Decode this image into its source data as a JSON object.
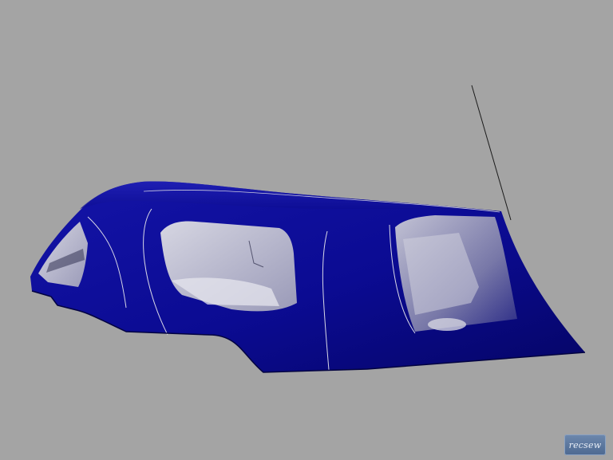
{
  "scene": {
    "subject": "boat-canopy-render",
    "colors": {
      "background": "#a4a4a4",
      "fabric": "#0a0a8e",
      "fabric_dark": "#04045c",
      "window_glass": "#c9c9d6",
      "seam": "#d8d8e6"
    },
    "watermark": {
      "text": "recsew"
    }
  }
}
